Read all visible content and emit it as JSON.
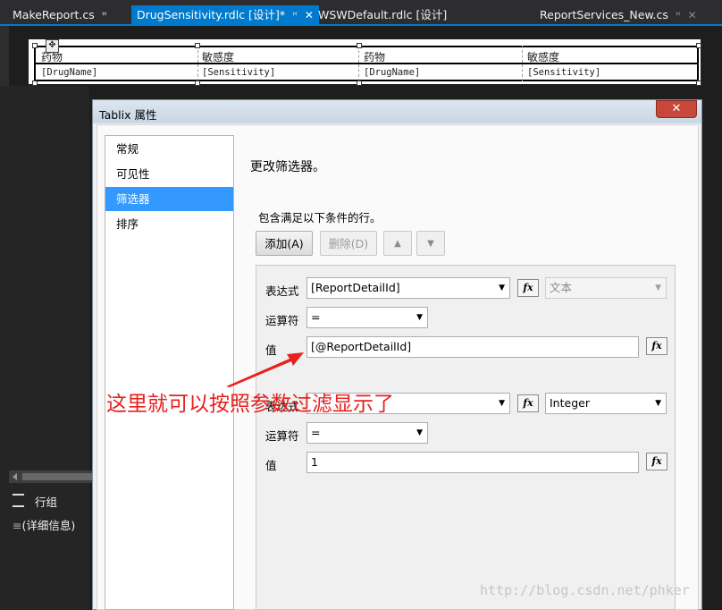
{
  "tabs": [
    {
      "label": "MakeReport.cs",
      "pin": "ꟸ"
    },
    {
      "label": "DrugSensitivity.rdlc [设计]*",
      "pin": "ꟸ",
      "close": "✕"
    },
    {
      "label": "WSWDefault.rdlc [设计]"
    },
    {
      "label": "ReportServices_New.cs",
      "pin": "ꟸ",
      "close": "✕"
    }
  ],
  "report": {
    "headers": [
      "药物",
      "敏感度",
      "药物",
      "敏感度"
    ],
    "fields": [
      "[DrugName]",
      "[Sensitivity]",
      "[DrugName]",
      "[Sensitivity]"
    ]
  },
  "side": {
    "rowgroup_label": "行组",
    "detail_label": "(详细信息)",
    "rowgroup_icon": "list-icon",
    "detail_icon": "equals-icon"
  },
  "dialog": {
    "title": "Tablix 属性",
    "close": "✕",
    "nav": [
      "常规",
      "可见性",
      "筛选器",
      "排序"
    ],
    "selected_nav": "筛选器",
    "heading": "更改筛选器。",
    "subheading": "包含满足以下条件的行。",
    "buttons": {
      "add": "添加(A)",
      "delete": "删除(D)",
      "up": "▲",
      "down": "▼"
    },
    "fx_label": "fx",
    "filters": [
      {
        "expr_label": "表达式",
        "expr": "[ReportDetailId]",
        "type": "文本",
        "op_label": "运算符",
        "op": "=",
        "val_label": "值",
        "value": "[@ReportDetailId]"
      },
      {
        "expr_label": "表达式",
        "expr": "",
        "type": "Integer",
        "op_label": "运算符",
        "op": "=",
        "val_label": "值",
        "value": "1"
      }
    ]
  },
  "annotation": "这里就可以按照参数过滤显示了",
  "watermark": "http://blog.csdn.net/phker",
  "colors": {
    "accent": "#007acc",
    "annotation": "#e8201f",
    "selected_nav": "#3399ff"
  }
}
